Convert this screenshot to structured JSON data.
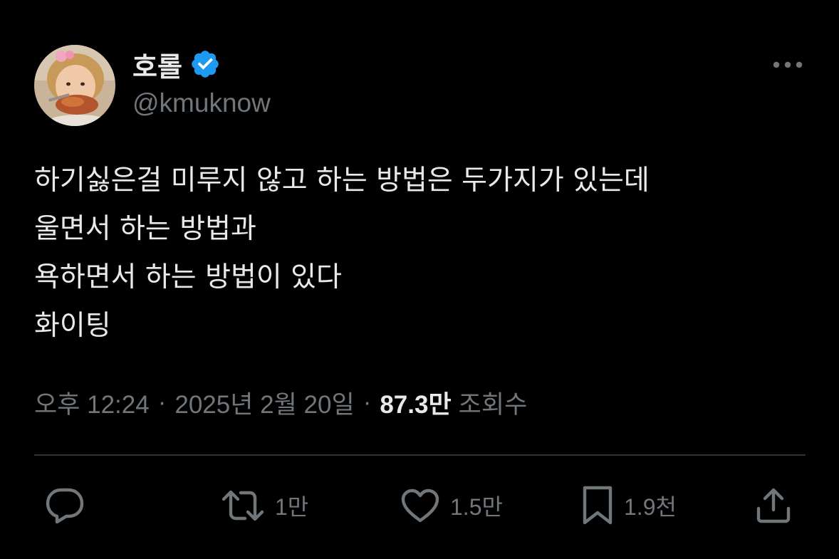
{
  "author": {
    "display_name": "호롤",
    "handle": "@kmuknow",
    "verified": true
  },
  "tweet": {
    "lines": [
      "하기싫은걸 미루지 않고 하는 방법은 두가지가 있는데",
      "울면서 하는 방법과",
      "욕하면서 하는 방법이 있다",
      "화이팅"
    ]
  },
  "meta": {
    "time": "오후 12:24",
    "separator": "·",
    "date": "2025년 2월 20일",
    "views_count": "87.3만",
    "views_label": "조회수"
  },
  "actions": {
    "reply_count": "",
    "retweet_count": "1만",
    "like_count": "1.5만",
    "bookmark_count": "1.9천"
  },
  "colors": {
    "background": "#000000",
    "primary_text": "#e7e9ea",
    "secondary_text": "#71767b",
    "verified_badge": "#1d9bf0",
    "divider": "#2f3336"
  },
  "icons": {
    "more": "more-horizontal-icon",
    "verified": "verified-badge-icon",
    "reply": "reply-bubble-icon",
    "retweet": "retweet-icon",
    "like": "heart-icon",
    "bookmark": "bookmark-icon",
    "share": "share-upload-icon"
  }
}
